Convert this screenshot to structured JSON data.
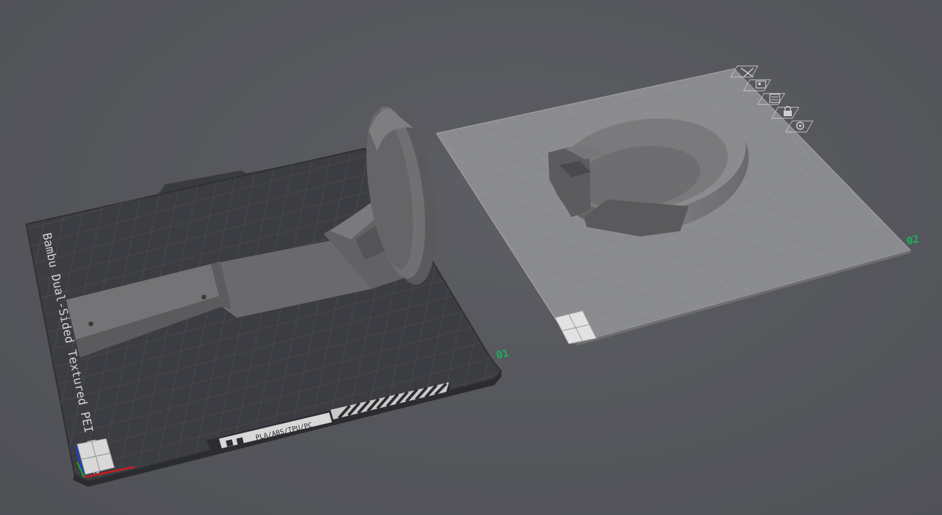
{
  "scene": {
    "plates": [
      {
        "id": "plate-01",
        "number_label": "01",
        "surface_text": "Bambu Dual-Sided Textured PEI Plate",
        "material_strip_text": "PLA/ABS/TPU/PC",
        "model": "bracket-arm with round cup mount"
      },
      {
        "id": "plate-02",
        "number_label": "02",
        "model": "round cup holder with square slot"
      }
    ],
    "plate_tools": [
      {
        "name": "close",
        "icon": "close-icon"
      },
      {
        "name": "arrange",
        "icon": "arrange-icon"
      },
      {
        "name": "orient",
        "icon": "orient-icon"
      },
      {
        "name": "lock",
        "icon": "lock-icon"
      },
      {
        "name": "settings",
        "icon": "gear-icon"
      }
    ],
    "colors": {
      "background": "#55565b",
      "plate_dark": "#3c3d42",
      "plate_light": "#8a8b8f",
      "grid_line": "#7f8085",
      "model_gray": "#6e6e70",
      "plate_number": "#18b35a",
      "axis_x": "#d01c1c",
      "axis_y": "#1c40d0",
      "axis_z": "#1cb01c"
    }
  }
}
